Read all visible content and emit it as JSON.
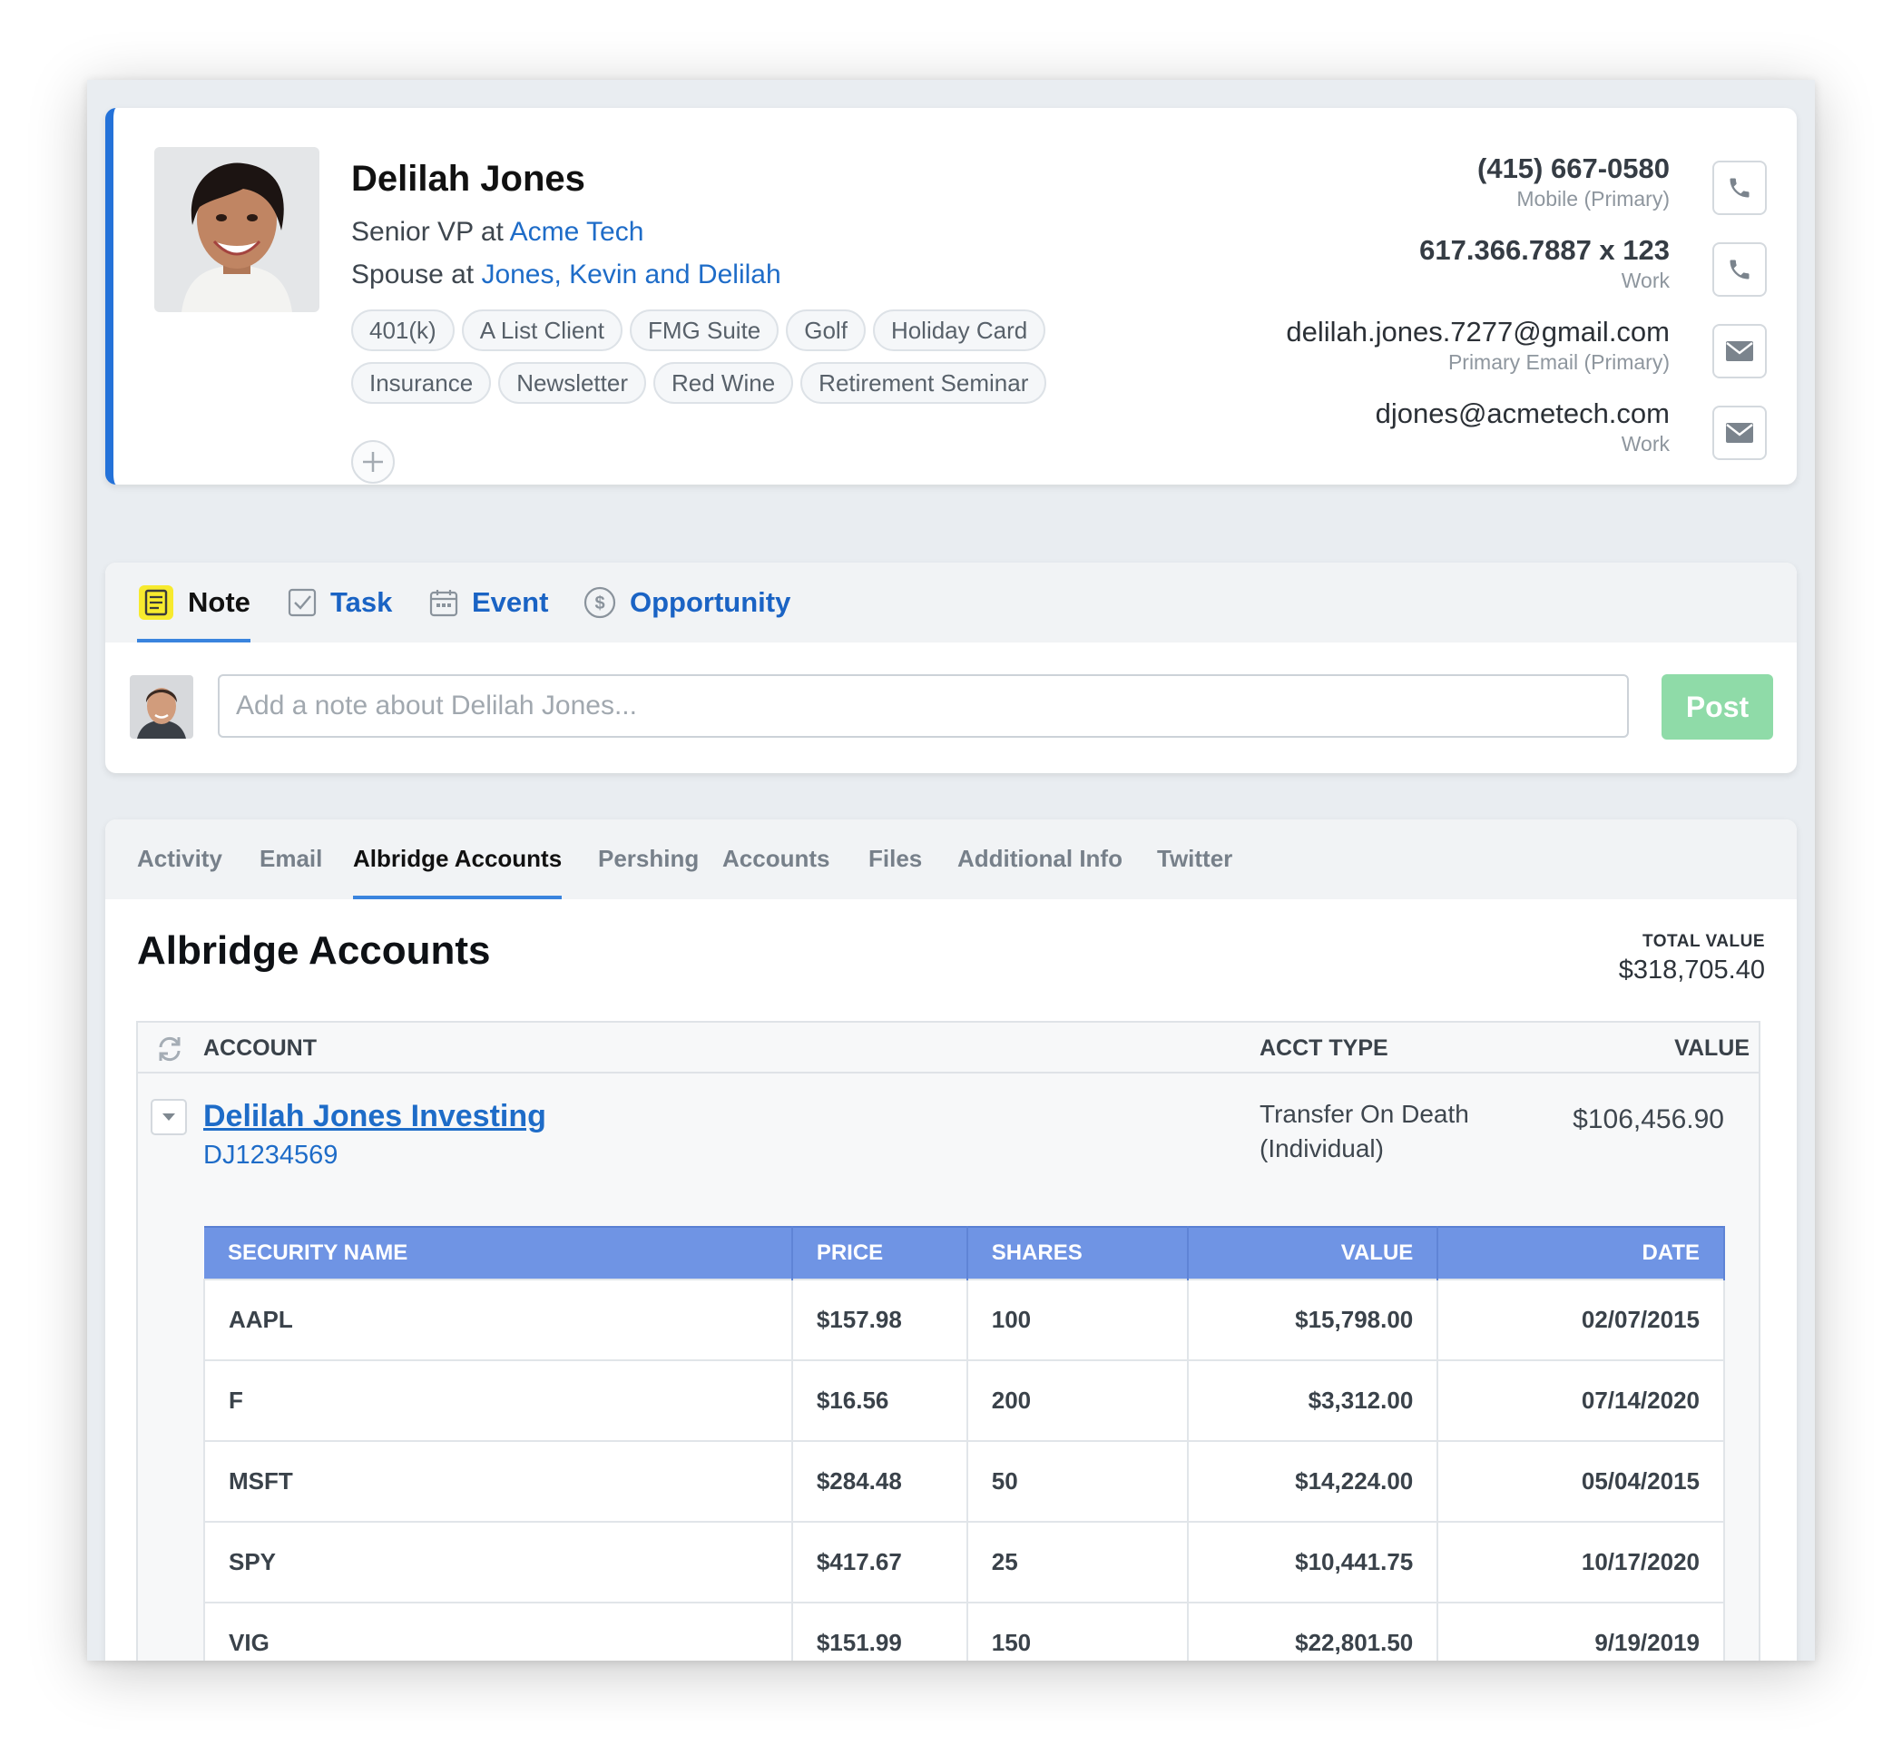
{
  "contact": {
    "name": "Delilah Jones",
    "role_prefix": "Senior VP at ",
    "company": "Acme Tech",
    "relation_prefix": "Spouse at ",
    "household": "Jones, Kevin and Delilah",
    "tags": [
      "401(k)",
      "A List Client",
      "FMG Suite",
      "Golf",
      "Holiday Card",
      "Insurance",
      "Newsletter",
      "Red Wine",
      "Retirement Seminar"
    ],
    "methods": [
      {
        "value": "(415) 667-0580",
        "label": "Mobile (Primary)",
        "icon": "phone-icon"
      },
      {
        "value": "617.366.7887 x 123",
        "label": "Work",
        "icon": "phone-icon"
      },
      {
        "value": "delilah.jones.7277@gmail.com",
        "label": "Primary Email (Primary)",
        "icon": "mail-icon"
      },
      {
        "value": "djones@acmetech.com",
        "label": "Work",
        "icon": "mail-icon"
      }
    ]
  },
  "composer": {
    "tabs": [
      {
        "label": "Note",
        "icon": "note-icon"
      },
      {
        "label": "Task",
        "icon": "checkbox-icon"
      },
      {
        "label": "Event",
        "icon": "calendar-icon"
      },
      {
        "label": "Opportunity",
        "icon": "dollar-icon"
      }
    ],
    "placeholder": "Add a note about Delilah Jones...",
    "post_label": "Post"
  },
  "panel": {
    "tabs": [
      "Activity",
      "Email",
      "Albridge Accounts",
      "Pershing",
      "Accounts",
      "Files",
      "Additional Info",
      "Twitter"
    ],
    "active_tab": "Albridge Accounts",
    "title": "Albridge Accounts",
    "total_label": "TOTAL VALUE",
    "total_value": "$318,705.40",
    "columns": {
      "account": "ACCOUNT",
      "acct_type": "ACCT TYPE",
      "value": "VALUE"
    },
    "account": {
      "name": "Delilah Jones Investing",
      "number": "DJ1234569",
      "type_line1": "Transfer On Death",
      "type_line2": "(Individual)",
      "value": "$106,456.90"
    },
    "security_columns": [
      "SECURITY NAME",
      "PRICE",
      "SHARES",
      "VALUE",
      "DATE"
    ],
    "securities": [
      [
        "AAPL",
        "$157.98",
        "100",
        "$15,798.00",
        "02/07/2015"
      ],
      [
        "F",
        "$16.56",
        "200",
        "$3,312.00",
        "07/14/2020"
      ],
      [
        "MSFT",
        "$284.48",
        "50",
        "$14,224.00",
        "05/04/2015"
      ],
      [
        "SPY",
        "$417.67",
        "25",
        "$10,441.75",
        "10/17/2020"
      ],
      [
        "VIG",
        "$151.99",
        "150",
        "$22,801.50",
        "9/19/2019"
      ]
    ]
  },
  "colors": {
    "accent": "#2472d9",
    "link": "#1e6cc8",
    "table_header": "#6f94e4",
    "post_button": "#8fdba8"
  }
}
